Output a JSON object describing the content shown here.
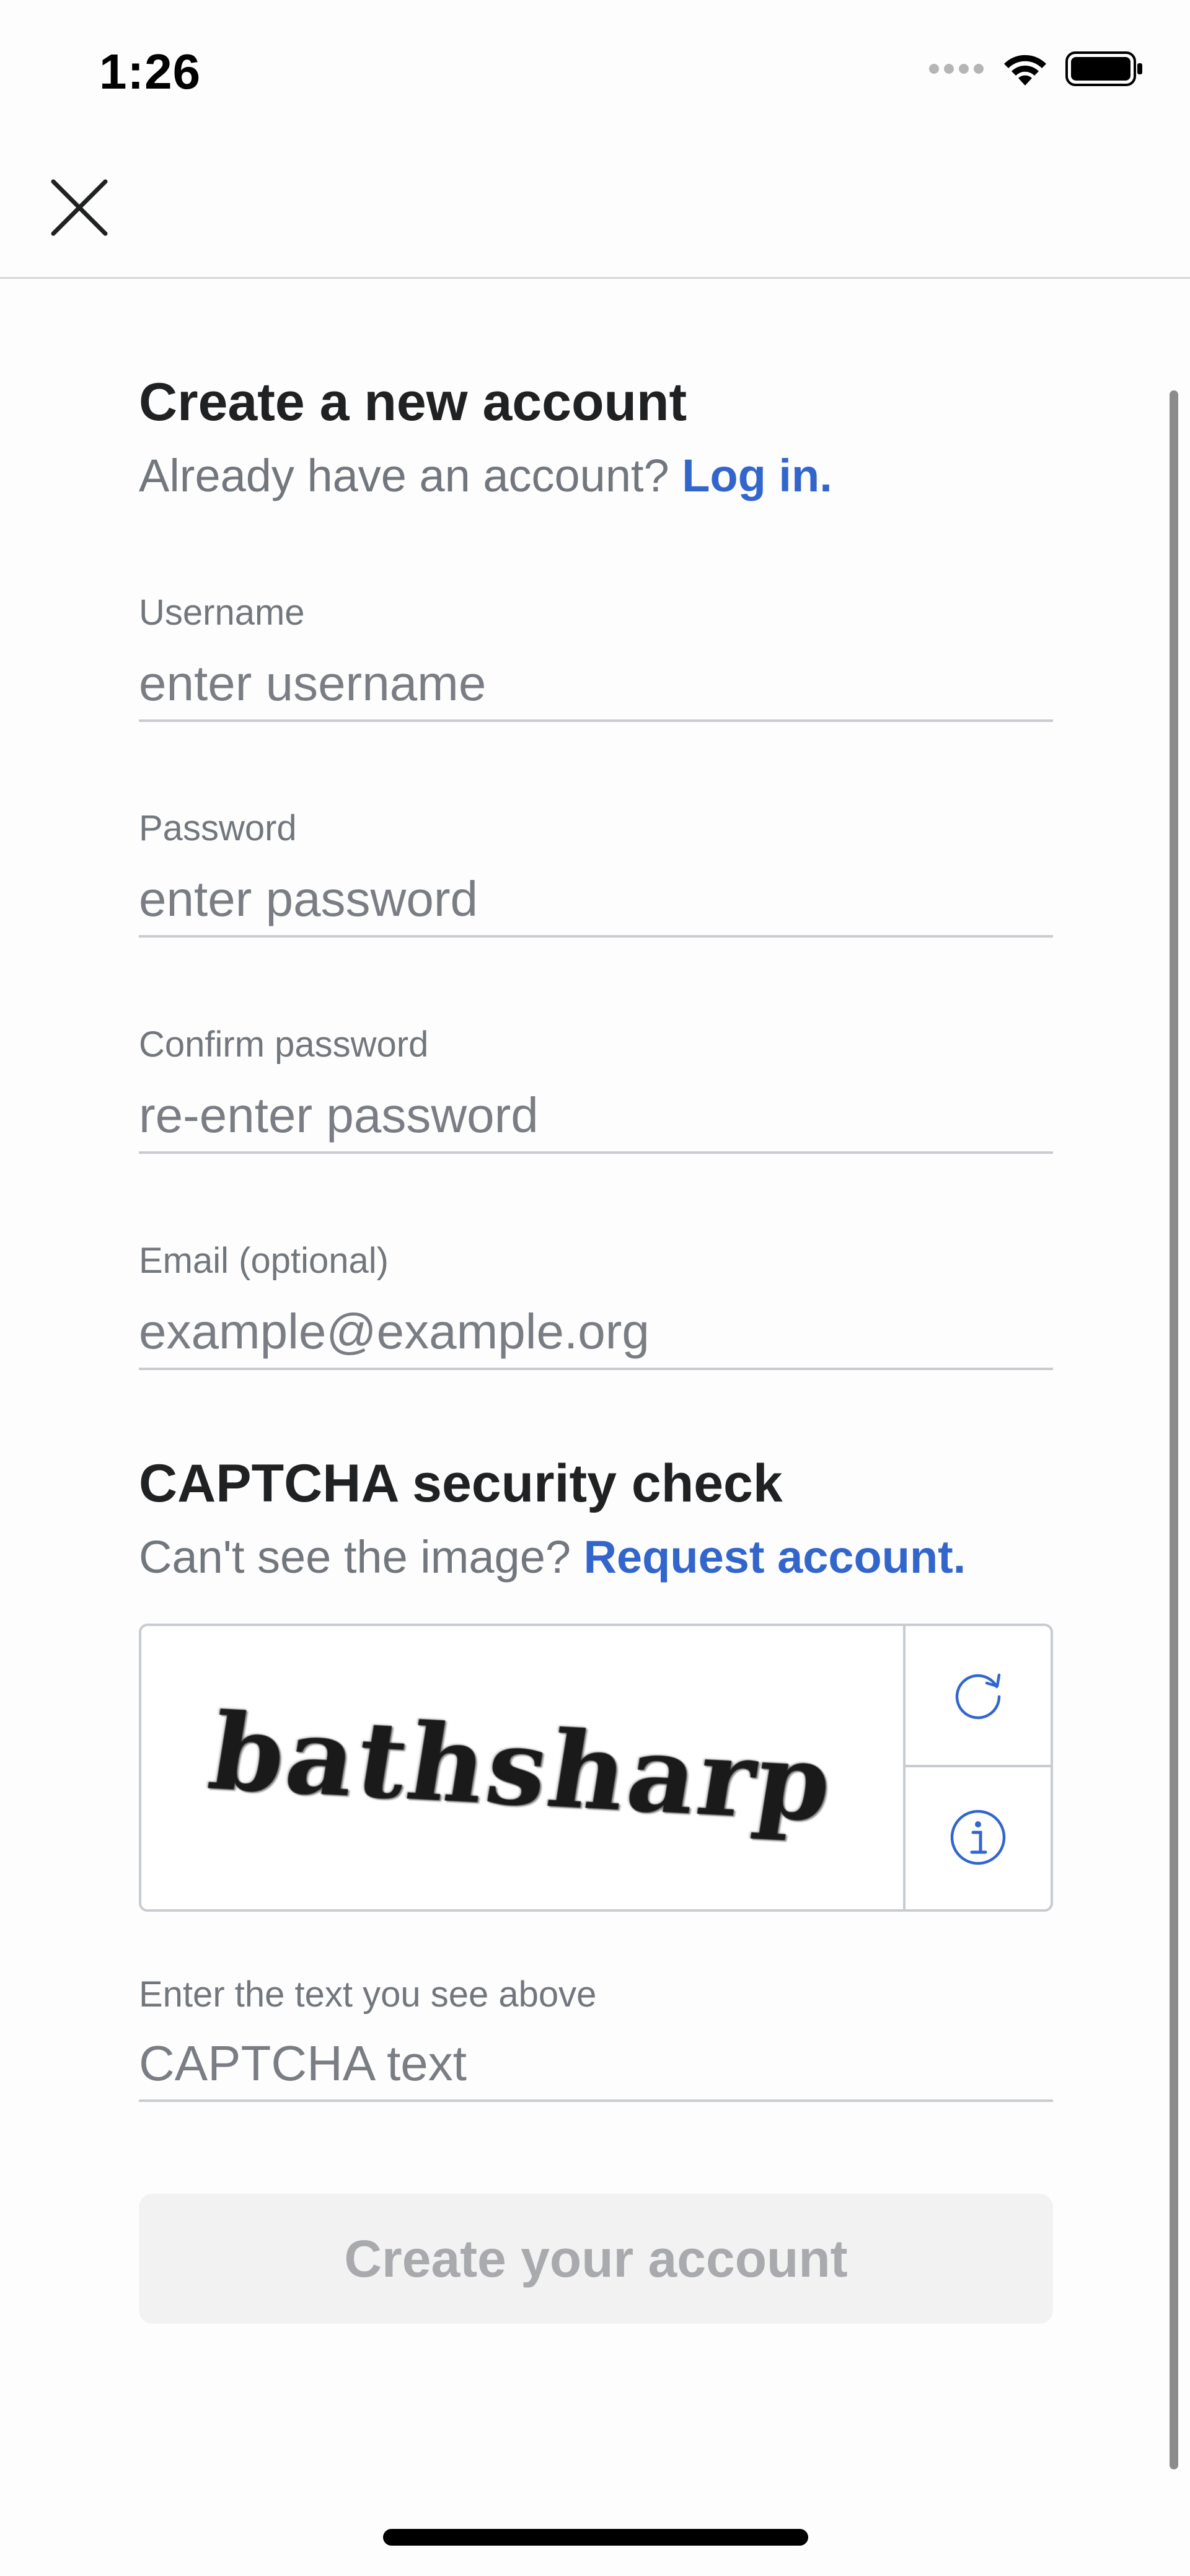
{
  "status_bar": {
    "time": "1:26",
    "icons": [
      "signal-icon",
      "wifi-icon",
      "battery-icon"
    ]
  },
  "nav": {
    "close_icon": "close-icon"
  },
  "account": {
    "title": "Create a new account",
    "login_prompt": "Already have an account?",
    "login_link": "Log in."
  },
  "fields": {
    "username": {
      "label": "Username",
      "placeholder": "enter username",
      "value": ""
    },
    "password": {
      "label": "Password",
      "placeholder": "enter password",
      "value": ""
    },
    "confirm": {
      "label": "Confirm password",
      "placeholder": "re-enter password",
      "value": ""
    },
    "email": {
      "label": "Email (optional)",
      "placeholder": "example@example.org",
      "value": ""
    }
  },
  "captcha": {
    "title": "CAPTCHA security check",
    "help_prompt": "Can't see the image?",
    "help_link": "Request account.",
    "image_text": "bathsharp",
    "refresh_icon": "refresh-icon",
    "info_icon": "info-icon",
    "input_label": "Enter the text you see above",
    "input_placeholder": "CAPTCHA text"
  },
  "actions": {
    "create_label": "Create your account"
  },
  "colors": {
    "accent": "#3366cc",
    "text": "#202122",
    "muted": "#72777d",
    "border": "#c8ccd1",
    "button_disabled_bg": "#f2f2f2",
    "button_disabled_text": "#a8aaad"
  }
}
